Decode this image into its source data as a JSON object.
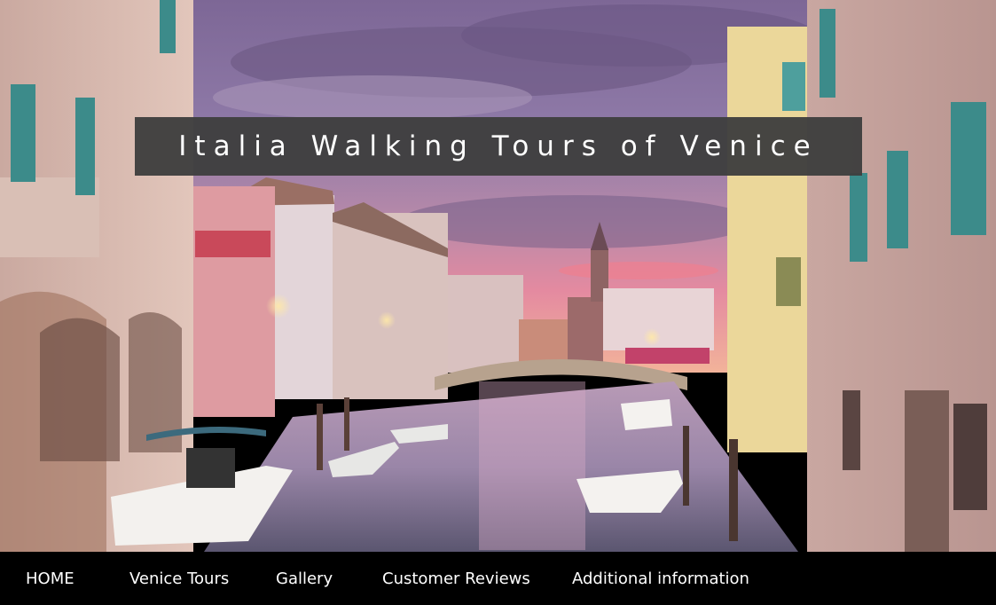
{
  "site": {
    "title": "Italia Walking Tours of Venice"
  },
  "hero": {
    "image": "venice-canal-at-dusk-photo"
  },
  "nav": {
    "items": [
      {
        "label": "HOME"
      },
      {
        "label": "Venice Tours"
      },
      {
        "label": "Gallery"
      },
      {
        "label": "Customer Reviews"
      },
      {
        "label": "Additional information"
      }
    ]
  },
  "colors": {
    "banner_bg": "#3e3e3e",
    "nav_bg": "#000000",
    "text": "#ffffff"
  }
}
